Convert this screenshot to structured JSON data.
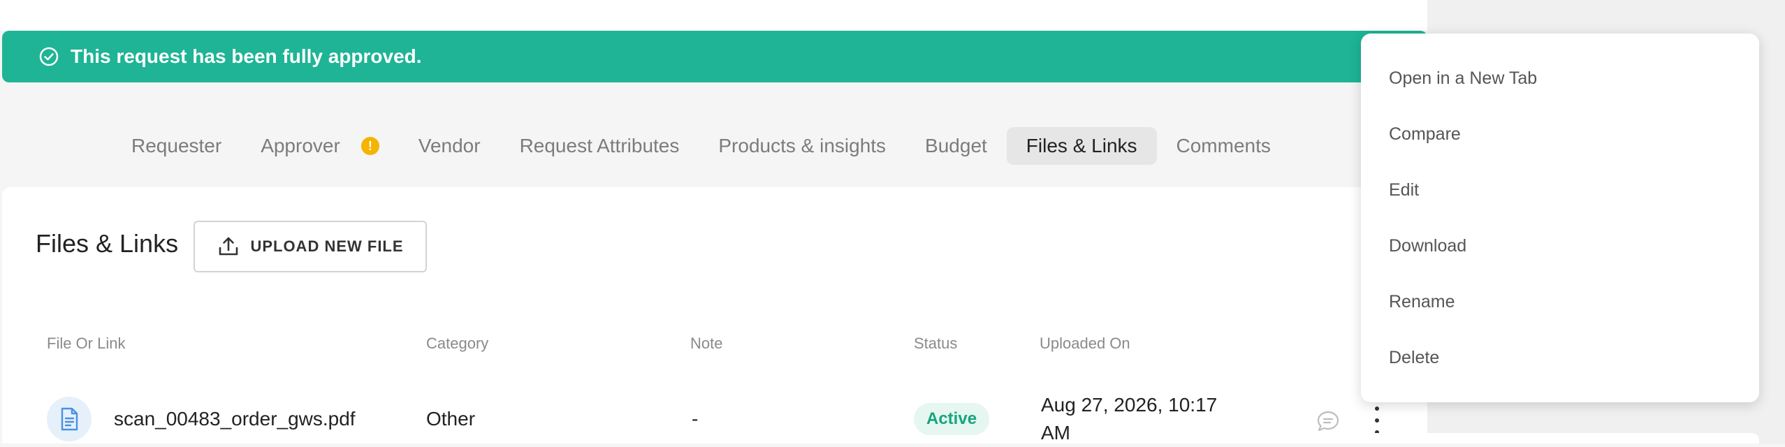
{
  "banner": {
    "message": "This request has been fully approved."
  },
  "tabs": [
    {
      "label": "Requester"
    },
    {
      "label": "Approver",
      "badge": "!"
    },
    {
      "label": "Vendor"
    },
    {
      "label": "Request Attributes"
    },
    {
      "label": "Products & insights"
    },
    {
      "label": "Budget"
    },
    {
      "label": "Files & Links",
      "active": true
    },
    {
      "label": "Comments"
    }
  ],
  "section": {
    "title": "Files & Links",
    "upload_label": "UPLOAD NEW FILE"
  },
  "table": {
    "headers": [
      "File Or Link",
      "Category",
      "Note",
      "Status",
      "Uploaded On"
    ],
    "rows": [
      {
        "file": "scan_00483_order_gws.pdf",
        "category": "Other",
        "note": "-",
        "status": "Active",
        "uploaded_line1": "Aug 27, 2026, 10:17",
        "uploaded_line2": "AM"
      }
    ]
  },
  "context_menu": {
    "items": [
      "Open in a New Tab",
      "Compare",
      "Edit",
      "Download",
      "Rename",
      "Delete"
    ]
  },
  "colors": {
    "banner": "#1eb495",
    "status_active": "#15a67c",
    "badge": "#f4b400"
  }
}
